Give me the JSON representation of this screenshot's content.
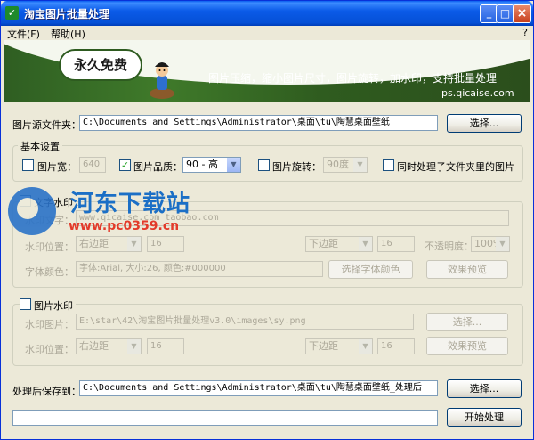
{
  "window": {
    "title": "淘宝图片批量处理"
  },
  "titlebar_buttons": {
    "minimize": "_",
    "maximize": "□",
    "close": "×"
  },
  "menu": {
    "file": "文件(F)",
    "help": "帮助(H)",
    "help_q": "?"
  },
  "banner": {
    "bubble": "永久免费",
    "slogan": "图片压缩，缩小图片尺寸，图片旋转，加水印，支持批量处理",
    "url": "ps.qicaise.com"
  },
  "source": {
    "label": "图片源文件夹：",
    "value": "C:\\Documents and Settings\\Administrator\\桌面\\tu\\陶慧桌面壁纸",
    "browse": "选择..."
  },
  "basic": {
    "title": "基本设置",
    "width_label": "图片宽：",
    "width_value": "640",
    "width_checked": false,
    "quality_label": "图片品质：",
    "quality_value": "90 - 高",
    "quality_checked": true,
    "rotate_label": "图片旋转：",
    "rotate_value": "90度",
    "rotate_checked": false,
    "subfolder_label": "同时处理子文件夹里的图片",
    "subfolder_checked": false
  },
  "text_wm": {
    "title": "文字水印",
    "checked": false,
    "text_label": "水印文字：",
    "text_value": "www.qicaise.com  taobao.com",
    "pos_label": "水印位置：",
    "pos_value": "右边距",
    "pos_num": "16",
    "pos2_value": "下边距",
    "pos2_num": "16",
    "opacity_label": "不透明度：",
    "opacity_value": "100%",
    "font_label": "字体颜色：",
    "font_value": "字体:Arial, 大小:26, 颜色:#000000",
    "font_button": "选择字体颜色",
    "preview_button": "效果预览"
  },
  "image_wm": {
    "title": "图片水印",
    "checked": false,
    "img_label": "水印图片：",
    "img_value": "E:\\star\\42\\淘宝图片批量处理v3.0\\images\\sy.png",
    "browse": "选择...",
    "pos_label": "水印位置：",
    "pos_value": "右边距",
    "pos_num": "16",
    "pos2_value": "下边距",
    "pos2_num": "16",
    "preview_button": "效果预览"
  },
  "output": {
    "label": "处理后保存到：",
    "value": "C:\\Documents and Settings\\Administrator\\桌面\\tu\\陶慧桌面壁纸_处理后",
    "browse": "选择..."
  },
  "start_button": "开始处理",
  "progress": {
    "value": 0
  },
  "watermark": {
    "title": "河东下载站",
    "url": "www.pc0359.cn"
  }
}
